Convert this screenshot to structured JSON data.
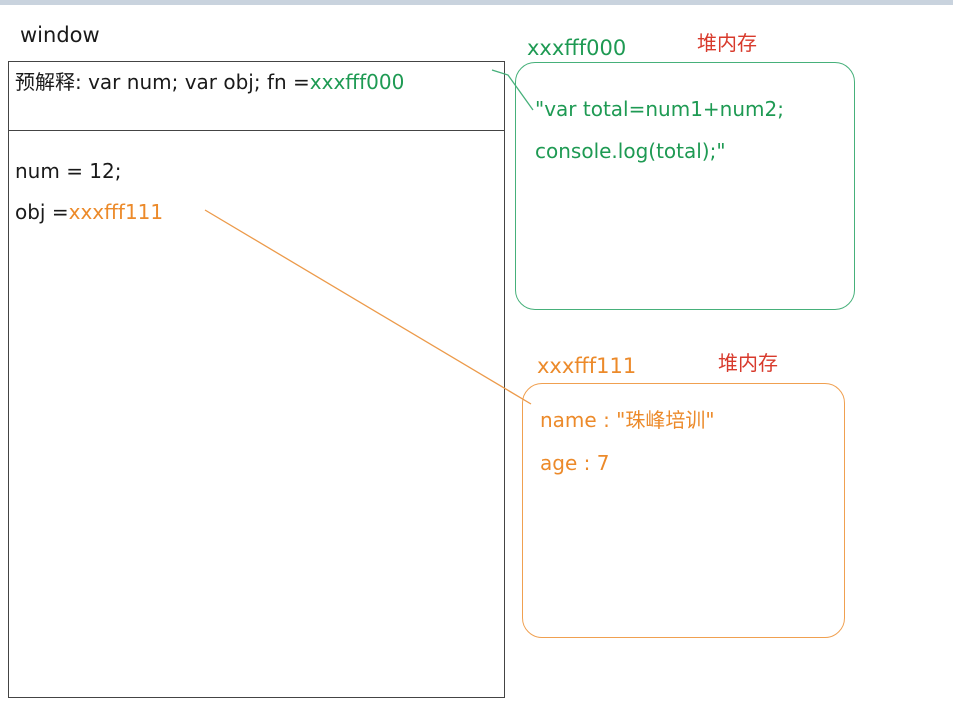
{
  "window": {
    "label": "window"
  },
  "preparse": {
    "label": "预解释: var num; var obj; fn =",
    "fn_address": "xxxfff000"
  },
  "code": {
    "num_line": "num = 12;",
    "obj_prefix": "obj =",
    "obj_address": "xxxfff111"
  },
  "heap_fn": {
    "address": "xxxfff000",
    "heap_label": "堆内存",
    "lines": [
      "\"var total=num1+num2;",
      "console.log(total);\""
    ]
  },
  "heap_obj": {
    "address": "xxxfff111",
    "heap_label": "堆内存",
    "lines": [
      "name : \"珠峰培训\"",
      "age : 7"
    ]
  },
  "colors": {
    "green": "#1e9a53",
    "orange": "#ec8a2a",
    "red": "#d83a2c"
  }
}
